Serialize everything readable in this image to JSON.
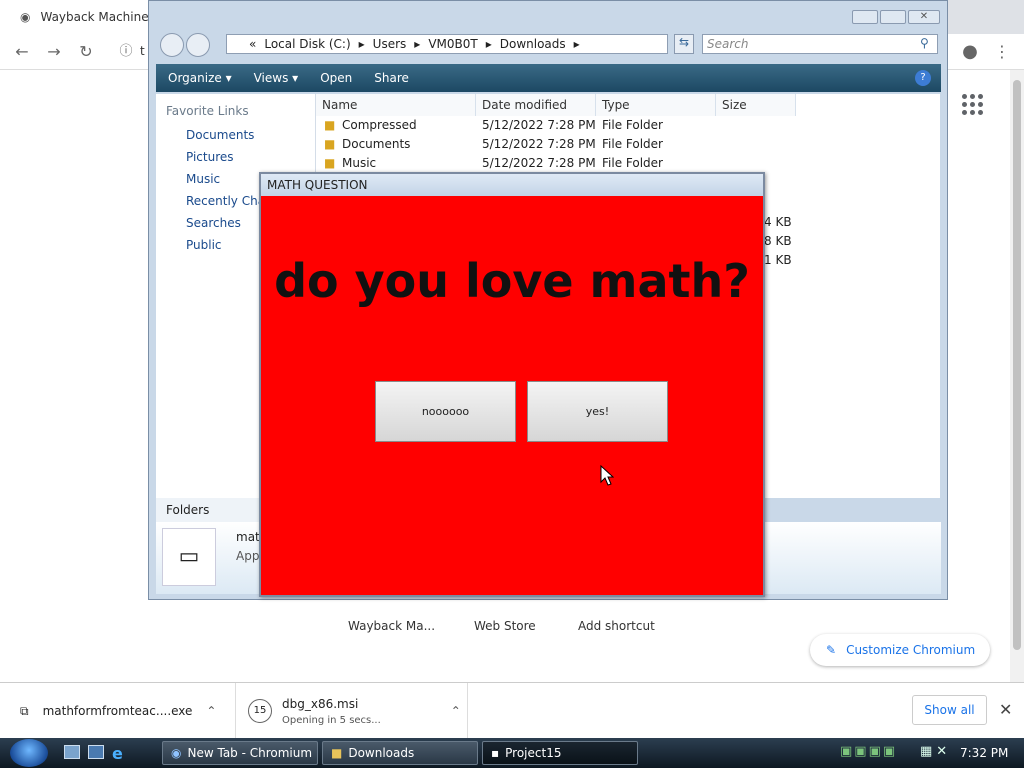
{
  "browser": {
    "tab_title": "Wayback Machine",
    "address_prefix": "t",
    "shortcuts": [
      "Wayback Ma...",
      "Web Store",
      "Add shortcut"
    ],
    "customize_label": "Customize Chromium"
  },
  "explorer": {
    "path": [
      "Local Disk (C:)",
      "Users",
      "VM0B0T",
      "Downloads"
    ],
    "path_prefix": "«",
    "search_placeholder": "Search",
    "commands": [
      "Organize",
      "Views",
      "Open",
      "Share"
    ],
    "favorite_links_title": "Favorite Links",
    "favorite_links": [
      "Documents",
      "Pictures",
      "Music",
      "Recently Chan",
      "Searches",
      "Public"
    ],
    "columns": [
      "Name",
      "Date modified",
      "Type",
      "Size"
    ],
    "rows": [
      {
        "name": "Compressed",
        "date": "5/12/2022 7:28 PM",
        "type": "File Folder",
        "size": ""
      },
      {
        "name": "Documents",
        "date": "5/12/2022 7:28 PM",
        "type": "File Folder",
        "size": ""
      },
      {
        "name": "Music",
        "date": "5/12/2022 7:28 PM",
        "type": "File Folder",
        "size": ""
      }
    ],
    "partial_sizes": [
      "4 KB",
      "8 KB",
      "1 KB"
    ],
    "folders_label": "Folders",
    "details_name": "mat",
    "details_type": "App"
  },
  "math_window": {
    "title": "MATH QUESTION",
    "question": "do you love math?",
    "button_no": "noooooo",
    "button_yes": "yes!",
    "background_color": "#ff0000"
  },
  "downloads": {
    "item1_name": "mathformfromteac....exe",
    "item2_name": "dbg_x86.msi",
    "item2_status": "Opening in 5 secs...",
    "show_all": "Show all"
  },
  "taskbar": {
    "tasks": [
      "New Tab - Chromium",
      "Downloads",
      "Project15"
    ],
    "clock": "7:32 PM"
  }
}
